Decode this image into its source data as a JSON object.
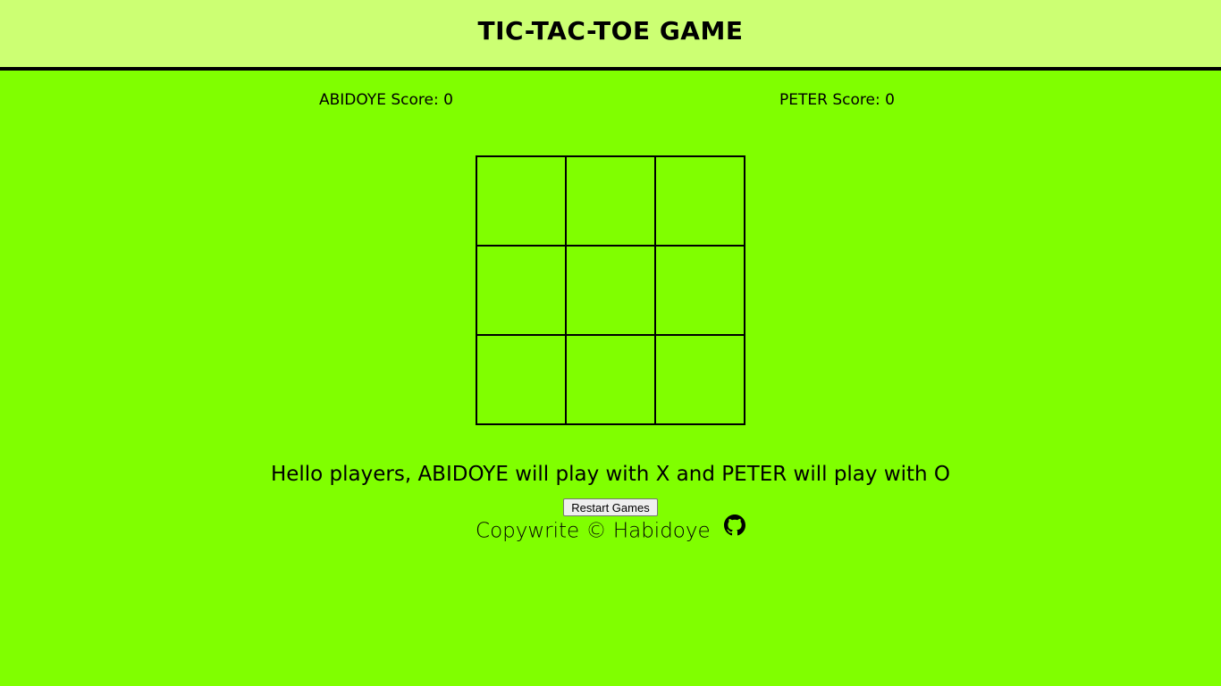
{
  "header": {
    "title": "TIC-TAC-TOE GAME"
  },
  "scores": {
    "player1": "ABIDOYE Score: 0",
    "player2": "PETER Score: 0"
  },
  "board": {
    "cells": [
      "",
      "",
      "",
      "",
      "",
      "",
      "",
      "",
      ""
    ]
  },
  "message": "Hello players, ABIDOYE will play with X and PETER will play with O",
  "restart_label": "Restart Games",
  "footer": {
    "text": "Copywrite © Habidoye",
    "icon": "github-icon"
  },
  "colors": {
    "background": "#80ff00",
    "header": "#ccff73"
  }
}
